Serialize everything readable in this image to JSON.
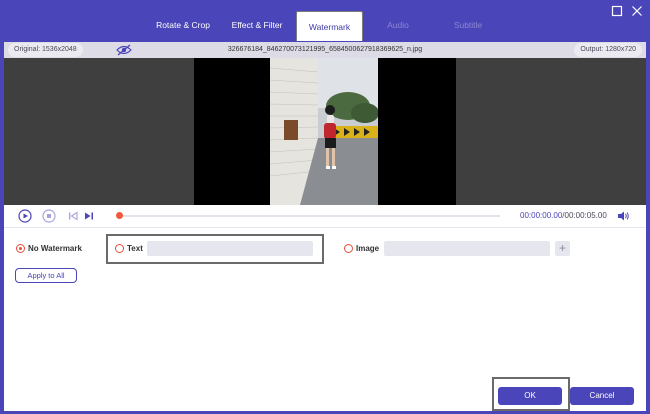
{
  "tabs": [
    {
      "label": "Rotate & Crop",
      "state": "normal"
    },
    {
      "label": "Effect & Filter",
      "state": "normal"
    },
    {
      "label": "Watermark",
      "state": "active"
    },
    {
      "label": "Audio",
      "state": "disabled"
    },
    {
      "label": "Subtitle",
      "state": "disabled"
    }
  ],
  "window": {
    "maximize_icon": "maximize-icon",
    "close_icon": "close-icon"
  },
  "info": {
    "original": "Original: 1536x2048",
    "filename": "326676184_846270073121995_6584500627918369625_n.jpg",
    "output": "Output: 1280x720",
    "eye_icon": "eye-slash-icon"
  },
  "player": {
    "current_time": "00:00:00.00",
    "separator": "/",
    "total_time": "00:00:05.00",
    "progress": 0
  },
  "watermark": {
    "no_watermark_label": "No Watermark",
    "text_label": "Text",
    "text_value": "",
    "image_label": "Image",
    "image_value": "",
    "selected": "no_watermark",
    "apply_label": "Apply to All"
  },
  "footer": {
    "ok_label": "OK",
    "cancel_label": "Cancel"
  },
  "colors": {
    "accent": "#4a45b8",
    "radio": "#e8503a",
    "progress": "#f05a3c"
  }
}
